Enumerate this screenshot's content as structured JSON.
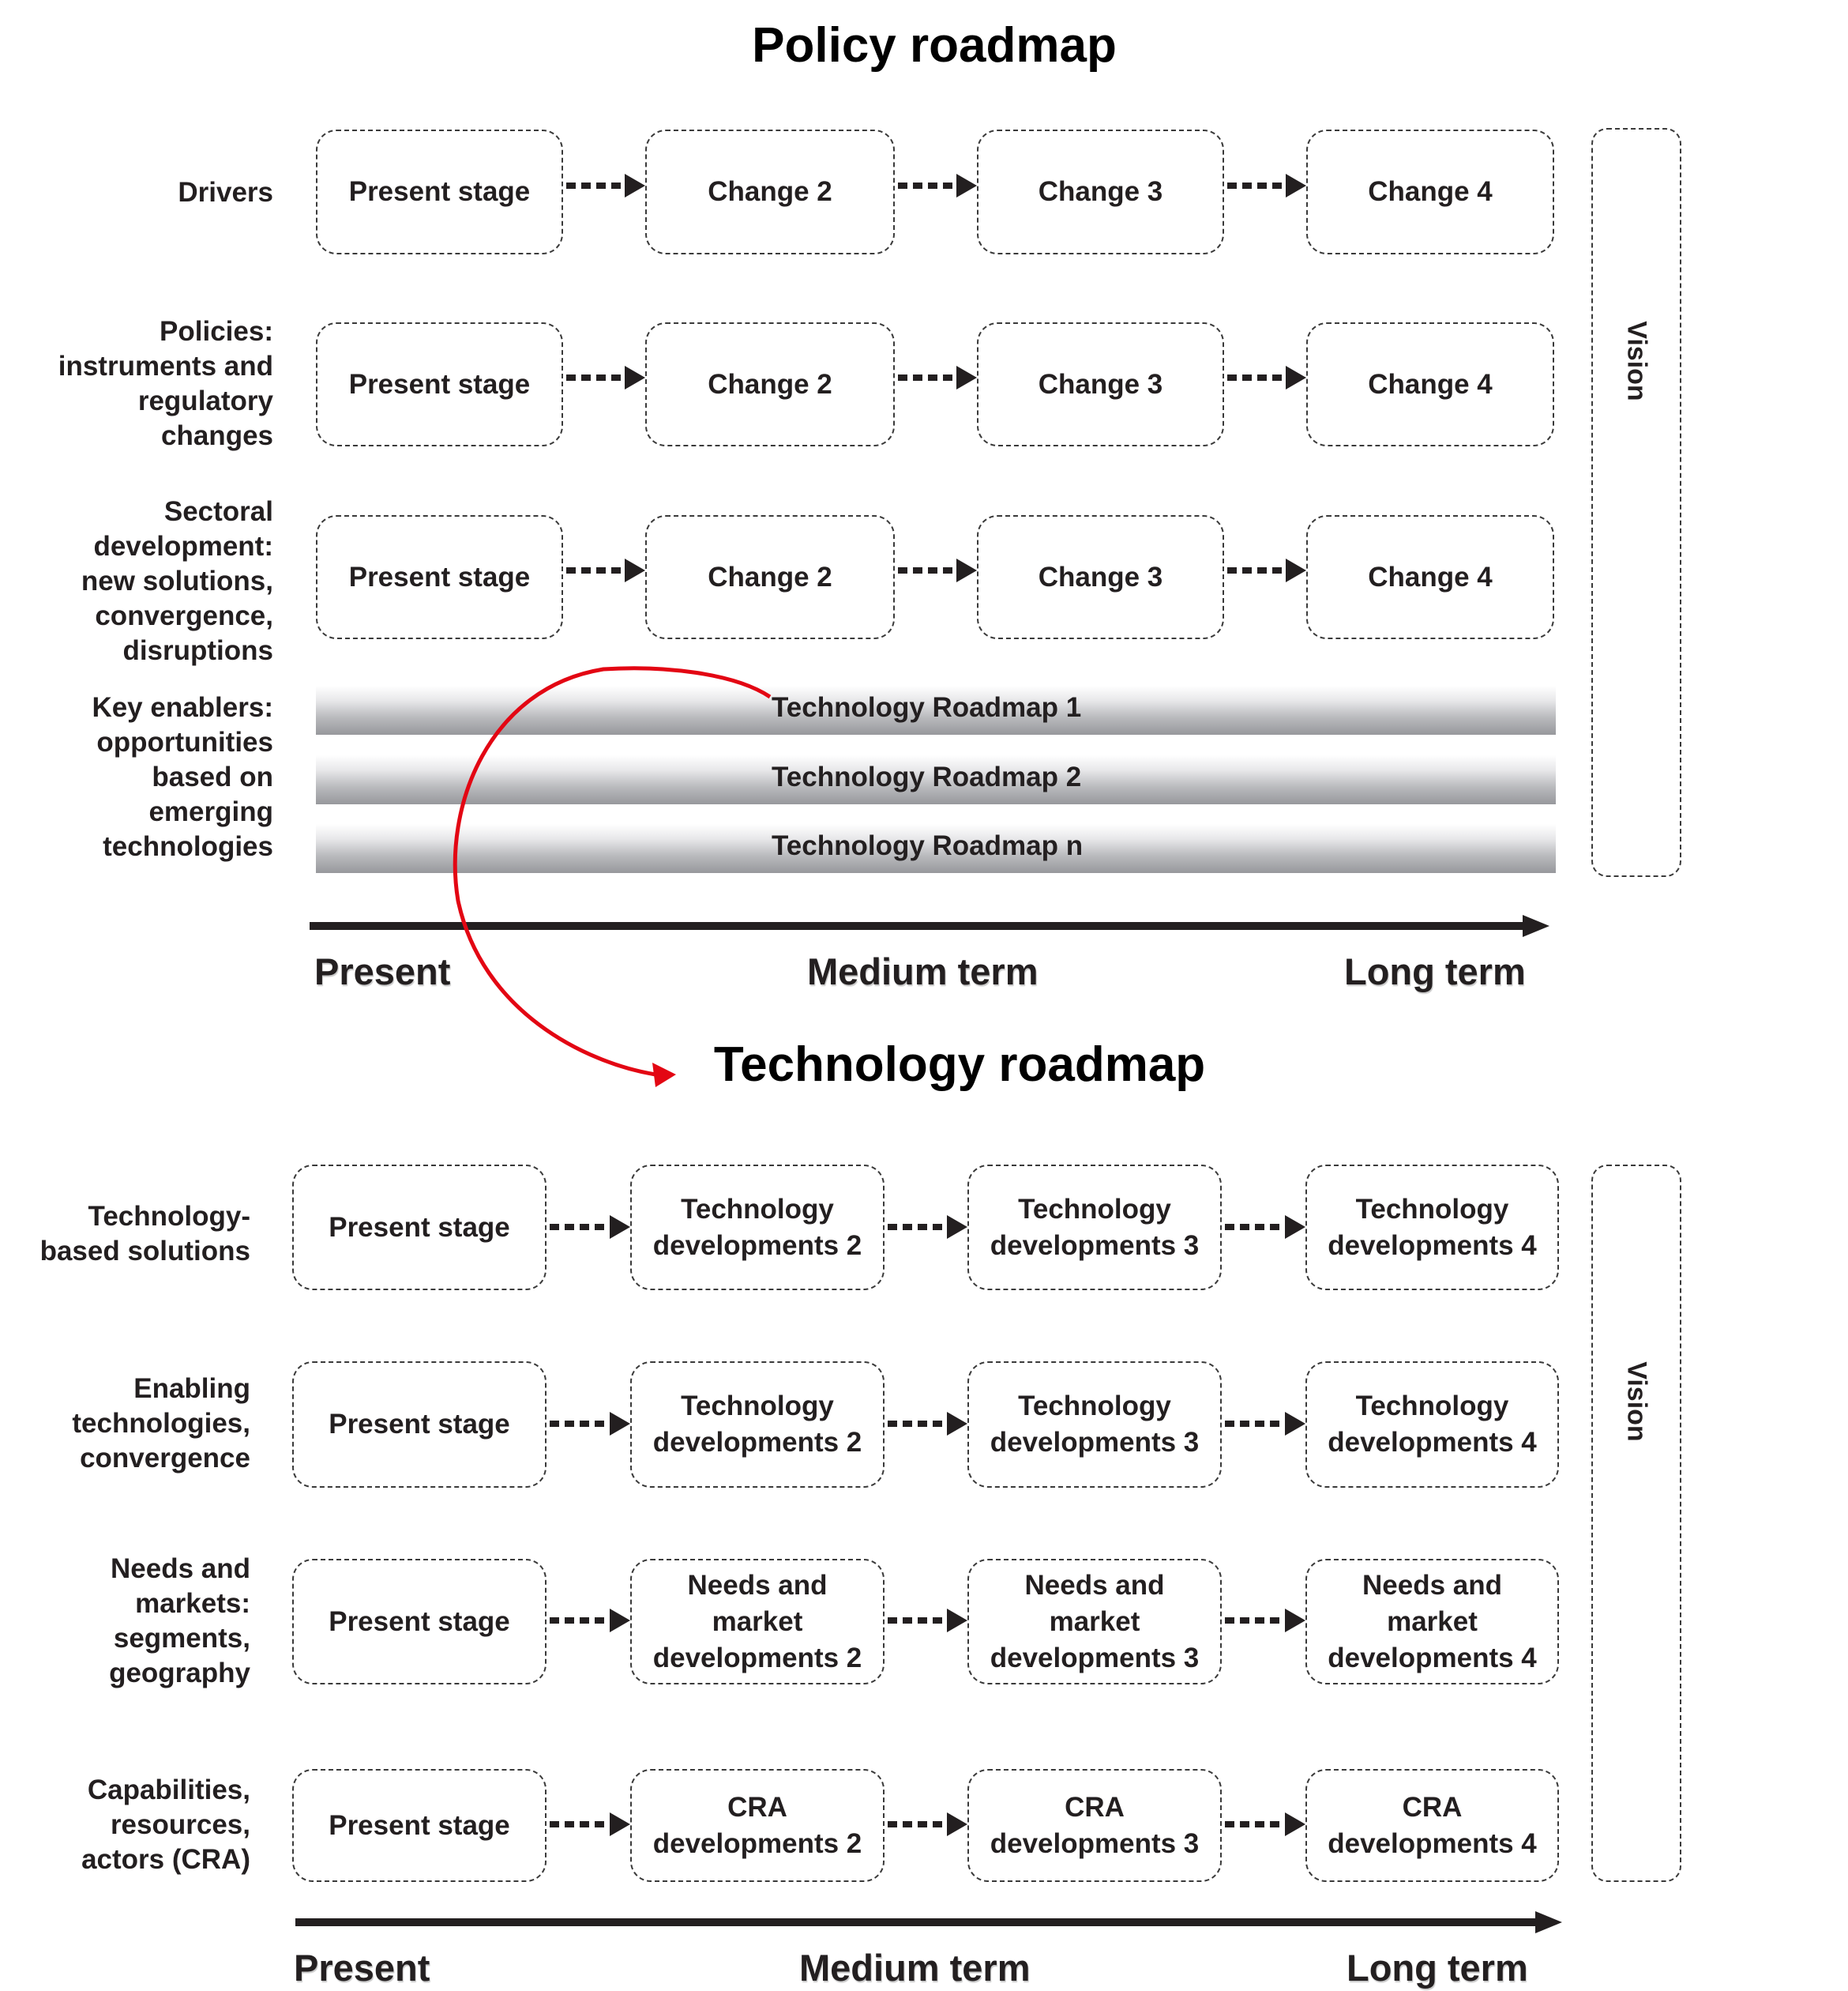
{
  "policy_roadmap": {
    "title": "Policy roadmap",
    "rows": [
      {
        "label": "Drivers",
        "stages": [
          "Present stage",
          "Change 2",
          "Change 3",
          "Change 4"
        ]
      },
      {
        "label": "Policies:\ninstruments and\nregulatory\nchanges",
        "stages": [
          "Present stage",
          "Change 2",
          "Change 3",
          "Change 4"
        ]
      },
      {
        "label": "Sectoral\ndevelopment:\nnew solutions,\nconvergence,\ndisruptions",
        "stages": [
          "Present stage",
          "Change 2",
          "Change 3",
          "Change 4"
        ]
      }
    ],
    "enablers_label": "Key enablers:\nopportunities\nbased on\nemerging\ntechnologies",
    "technology_roadmaps": [
      "Technology Roadmap 1",
      "Technology Roadmap 2",
      "Technology Roadmap n"
    ],
    "vision_label": "Vision",
    "timeline": [
      "Present",
      "Medium term",
      "Long term"
    ]
  },
  "technology_roadmap": {
    "title": "Technology roadmap",
    "rows": [
      {
        "label": "Technology-\nbased solutions",
        "stages": [
          "Present stage",
          "Technology\ndevelopments 2",
          "Technology\ndevelopments 3",
          "Technology\ndevelopments 4"
        ]
      },
      {
        "label": "Enabling\ntechnologies,\nconvergence",
        "stages": [
          "Present stage",
          "Technology\ndevelopments 2",
          "Technology\ndevelopments 3",
          "Technology\ndevelopments 4"
        ]
      },
      {
        "label": "Needs and\nmarkets:\nsegments,\ngeography",
        "stages": [
          "Present stage",
          "Needs and\nmarket\ndevelopments 2",
          "Needs and\nmarket\ndevelopments 3",
          "Needs and\nmarket\ndevelopments 4"
        ]
      },
      {
        "label": "Capabilities,\nresources,\nactors (CRA)",
        "stages": [
          "Present stage",
          "CRA\ndevelopments 2",
          "CRA\ndevelopments 3",
          "CRA\ndevelopments 4"
        ]
      }
    ],
    "vision_label": "Vision",
    "timeline": [
      "Present",
      "Medium term",
      "Long term"
    ]
  },
  "colors": {
    "text": "#231f20",
    "link_arrow": "#e30613",
    "bar_dark": "#97989c"
  }
}
